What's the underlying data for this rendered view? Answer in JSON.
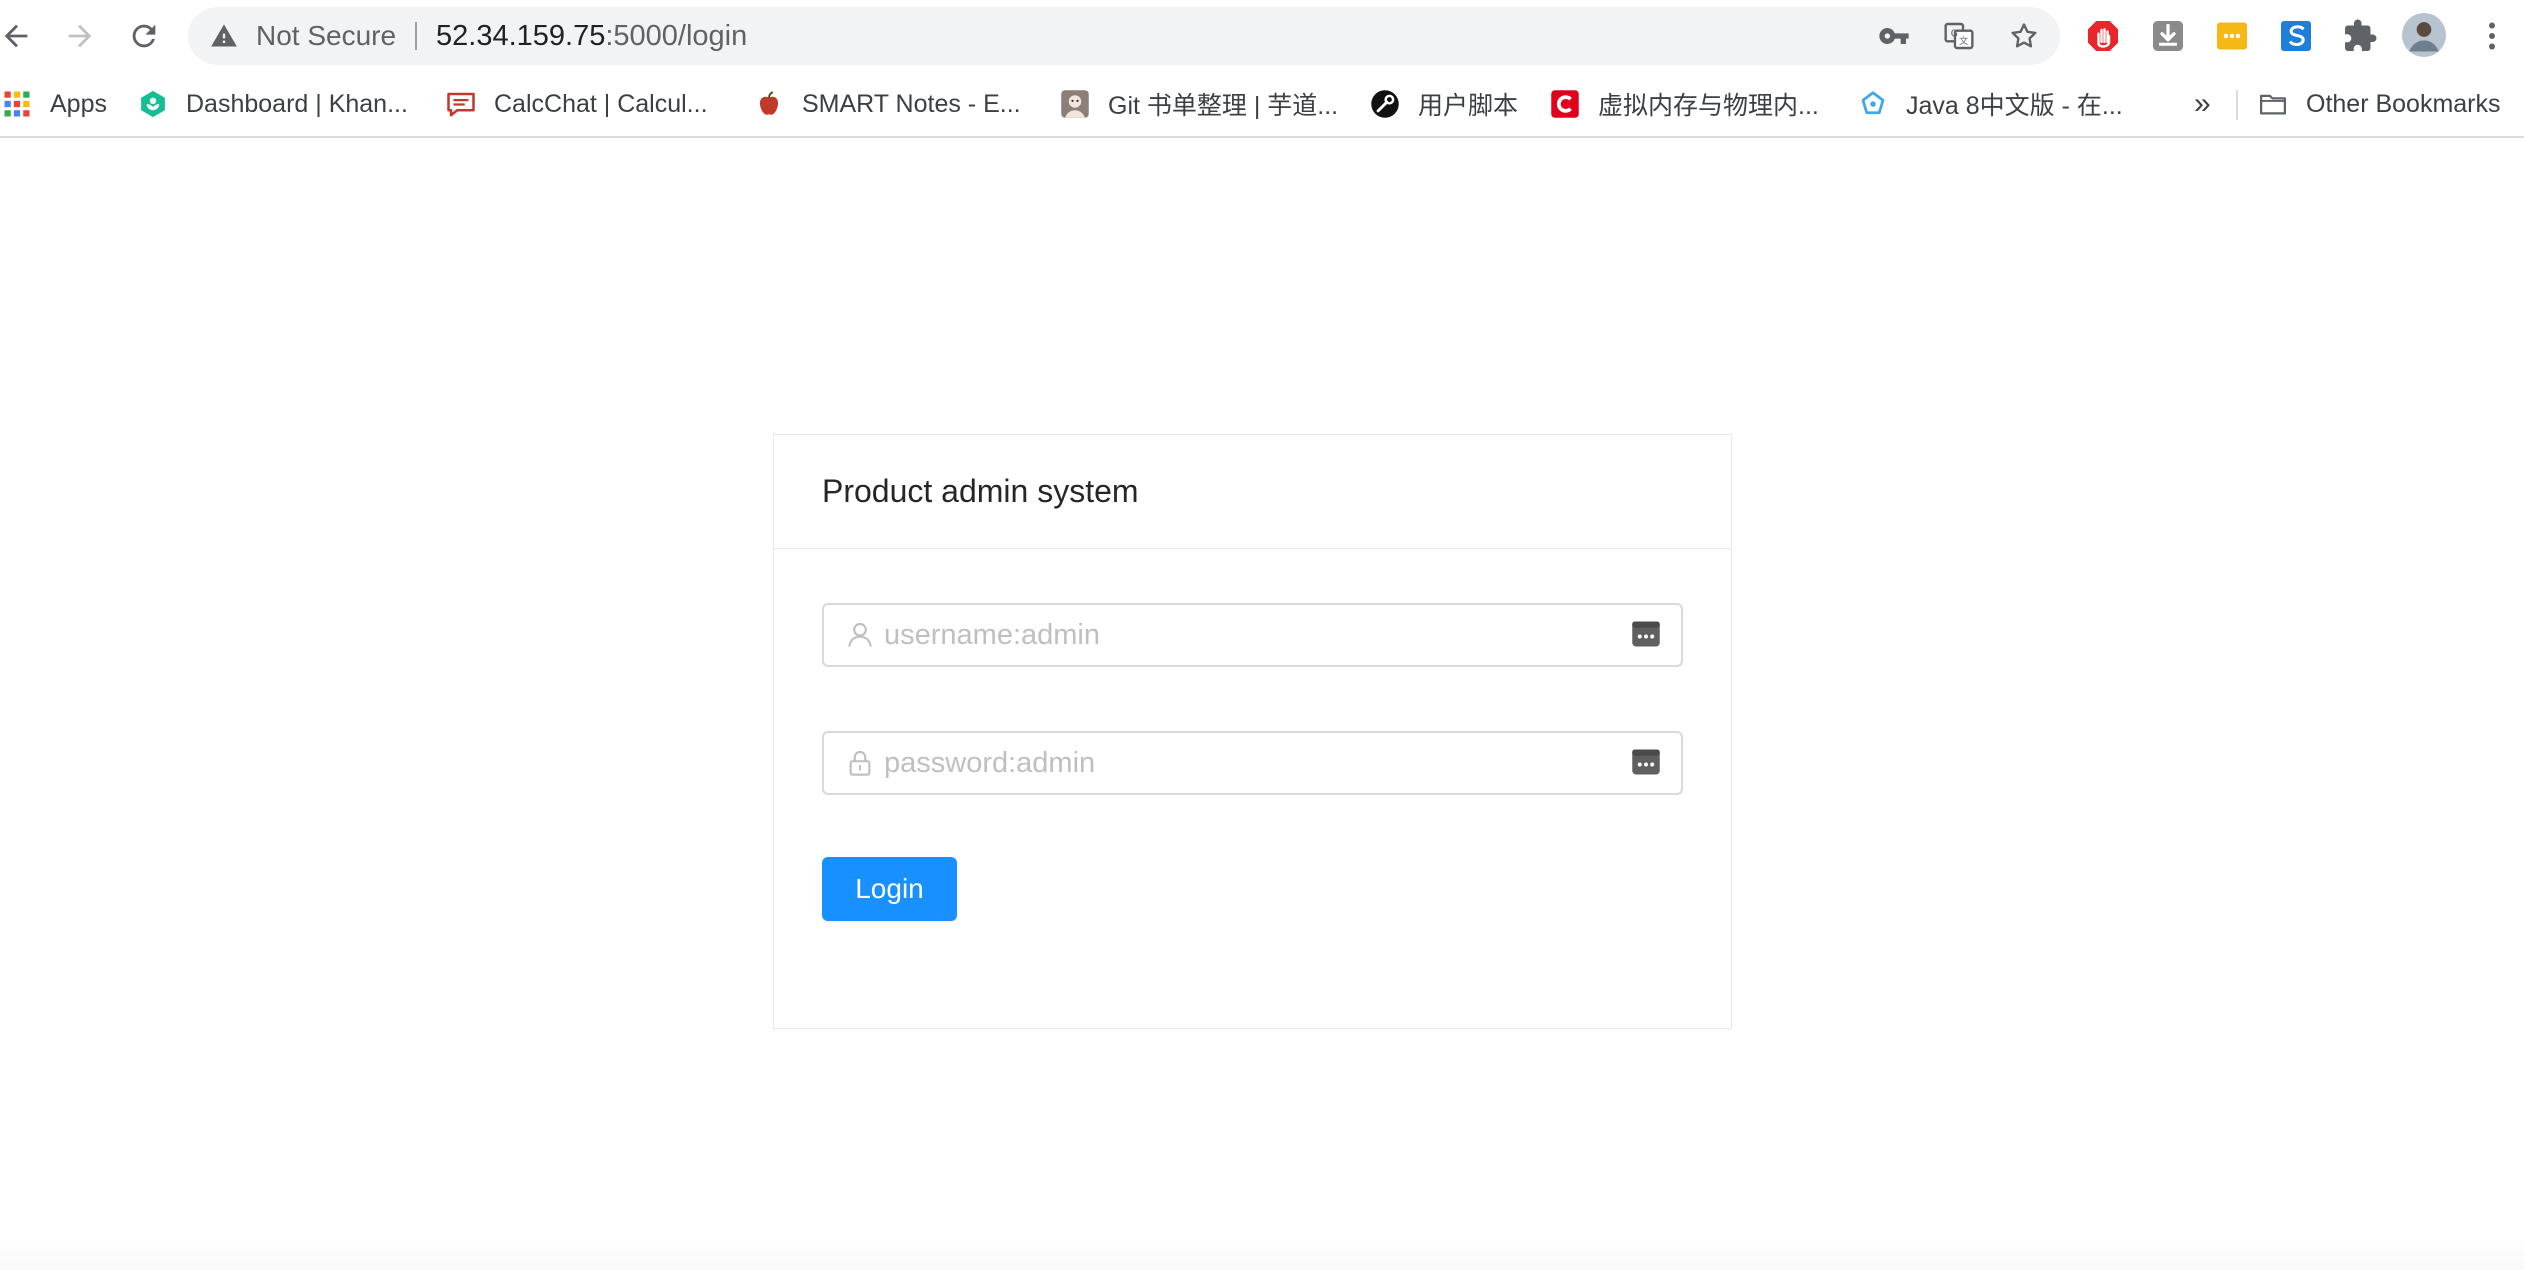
{
  "browser": {
    "security_label": "Not Secure",
    "url_host": "52.34.159.75",
    "url_rest": ":5000/login"
  },
  "bookmarks": {
    "apps_label": "Apps",
    "items": [
      {
        "label": "Dashboard | Khan...",
        "icon": "khan-academy-icon",
        "color": "#14bf96"
      },
      {
        "label": "CalcChat | Calcul...",
        "icon": "calcchat-icon",
        "color": "#c0392b"
      },
      {
        "label": "SMART Notes - E...",
        "icon": "apple-icon",
        "color": "#c0392b"
      },
      {
        "label": "Git 书单整理 | 芋道...",
        "icon": "avatar-icon",
        "color": "#888888"
      },
      {
        "label": "用户脚本",
        "icon": "tampermonkey-icon",
        "color": "#111111"
      },
      {
        "label": "虚拟内存与物理内...",
        "icon": "csdn-icon",
        "color": "#e0001b"
      },
      {
        "label": "Java 8中文版 - 在...",
        "icon": "runoob-icon",
        "color": "#3da9e8"
      }
    ],
    "more_label": "»",
    "other_label": "Other Bookmarks"
  },
  "login": {
    "title": "Product admin system",
    "username_placeholder": "username:admin",
    "password_placeholder": "password:admin",
    "button_label": "Login",
    "accent_color": "#1890ff"
  }
}
